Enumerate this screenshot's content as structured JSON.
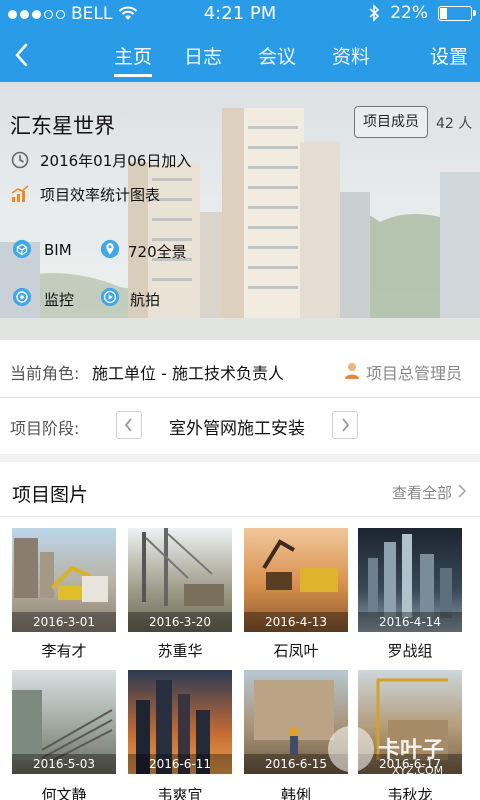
{
  "status_bar": {
    "carrier": "BELL",
    "time": "4:21 PM",
    "battery": "22%",
    "battery_level": 0.22
  },
  "nav": {
    "tabs": [
      {
        "label": "主页",
        "active": true
      },
      {
        "label": "日志",
        "active": false
      },
      {
        "label": "会议",
        "active": false
      },
      {
        "label": "资料",
        "active": false
      }
    ],
    "settings": "设置"
  },
  "project": {
    "name": "汇东星世界",
    "members_button": "项目成员",
    "members_count": "42 人",
    "joined": "2016年01月06日加入",
    "efficiency": "项目效率统计图表",
    "links": [
      {
        "label": "BIM",
        "icon": "bim-icon"
      },
      {
        "label": "720全景",
        "icon": "location-pin-icon"
      },
      {
        "label": "监控",
        "icon": "monitor-icon"
      },
      {
        "label": "航拍",
        "icon": "play-icon"
      }
    ]
  },
  "role": {
    "label": "当前角色:",
    "value": "施工单位 - 施工技术负责人",
    "admin": "项目总管理员"
  },
  "stage": {
    "label": "项目阶段:",
    "value": "室外管网施工安装"
  },
  "photos": {
    "title": "项目图片",
    "see_all": "查看全部",
    "items": [
      {
        "date": "2016-3-01",
        "name": "李有才"
      },
      {
        "date": "2016-3-20",
        "name": "苏重华"
      },
      {
        "date": "2016-4-13",
        "name": "石凤叶"
      },
      {
        "date": "2016-4-14",
        "name": "罗战组"
      },
      {
        "date": "2016-5-03",
        "name": "何文静"
      },
      {
        "date": "2016-6-11",
        "name": "韦爽宜"
      },
      {
        "date": "2016-6-15",
        "name": "韩俐"
      },
      {
        "date": "2016-6-17",
        "name": "韦秋龙"
      }
    ]
  },
  "watermark": {
    "text": "卡叶子",
    "sub": "XYZ.COM"
  },
  "colors": {
    "primary": "#2a9be6",
    "icon_blue": "#3fa7ea",
    "chart_orange": "#f08a24"
  }
}
